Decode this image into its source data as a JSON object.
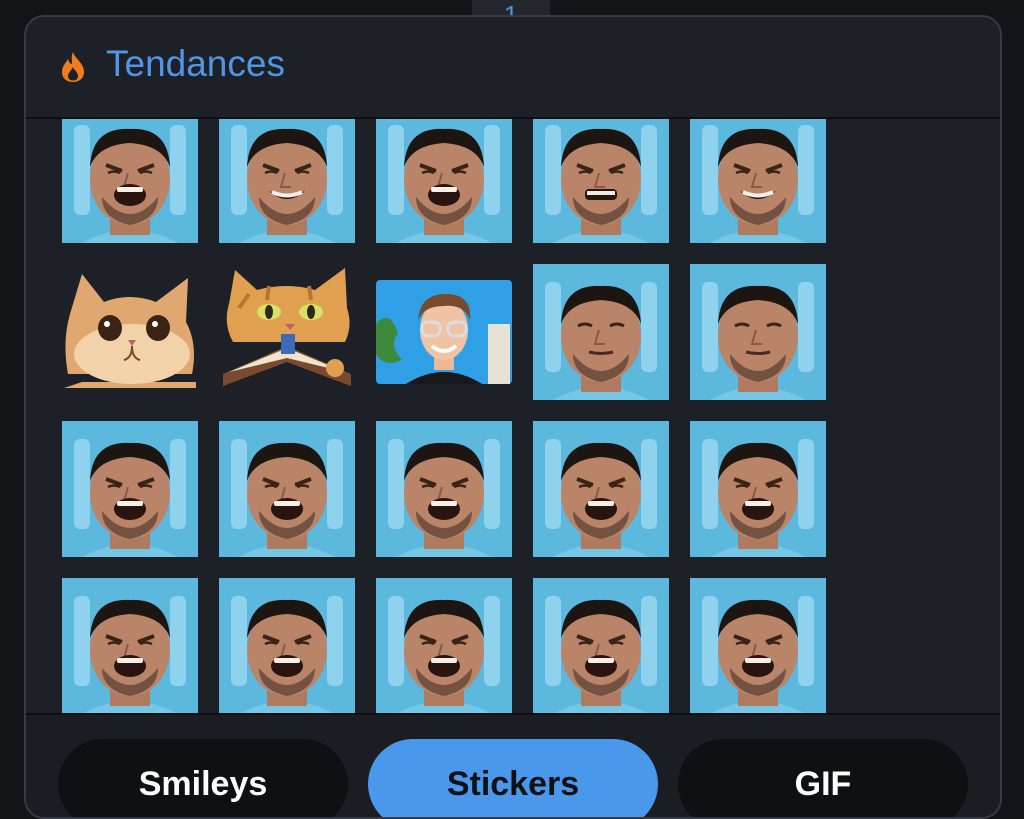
{
  "background_hint": "1",
  "header": {
    "icon": "flame-icon",
    "title": "Tendances",
    "title_color": "#4f96e6"
  },
  "stickers": [
    {
      "kind": "face",
      "expr": "scream"
    },
    {
      "kind": "face",
      "expr": "grin"
    },
    {
      "kind": "face",
      "expr": "scream"
    },
    {
      "kind": "face",
      "expr": "grit"
    },
    {
      "kind": "face",
      "expr": "grin"
    },
    {
      "kind": "cat"
    },
    {
      "kind": "cat-book"
    },
    {
      "kind": "man-glasses"
    },
    {
      "kind": "face",
      "expr": "calm"
    },
    {
      "kind": "face",
      "expr": "calm"
    },
    {
      "kind": "face",
      "expr": "scream"
    },
    {
      "kind": "face",
      "expr": "scream"
    },
    {
      "kind": "face",
      "expr": "scream"
    },
    {
      "kind": "face",
      "expr": "scream"
    },
    {
      "kind": "face",
      "expr": "scream"
    },
    {
      "kind": "face",
      "expr": "scream"
    },
    {
      "kind": "face",
      "expr": "scream"
    },
    {
      "kind": "face",
      "expr": "scream"
    },
    {
      "kind": "face",
      "expr": "scream"
    },
    {
      "kind": "face",
      "expr": "scream"
    }
  ],
  "tabs": [
    {
      "label": "Smileys",
      "active": false
    },
    {
      "label": "Stickers",
      "active": true
    },
    {
      "label": "GIF",
      "active": false
    }
  ],
  "colors": {
    "panel_bg": "#1e2027",
    "sticker_bg": "#5bb8dc",
    "active_tab": "#4a98ec"
  }
}
